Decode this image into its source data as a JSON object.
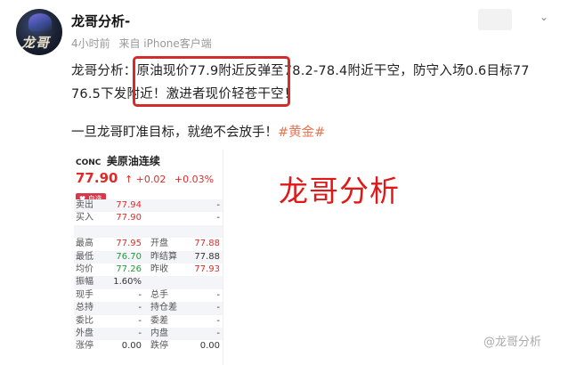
{
  "author": {
    "name": "龙哥分析-",
    "avatar_text": "龙哥"
  },
  "meta": {
    "time": "4小时前",
    "source": "来自 iPhone客户端"
  },
  "post": {
    "line1": "龙哥分析：原油现价77.9附近反弹至78.2-78.4附近干空，防守入场0.6目标77",
    "line2": "76.5下发附近！激进者现价轻苍干空！",
    "line3": "一旦龙哥盯准目标，就绝不会放手！",
    "hashtag": "#黄金#"
  },
  "quote": {
    "code": "CONC",
    "name": "美原油连续",
    "price": "77.90",
    "arrow": "↑",
    "change": "+0.02",
    "change_pct": "+0.03%",
    "tag": "自选",
    "rows": [
      {
        "l1": "卖出",
        "v1": "77.94",
        "l2": "",
        "v2": "-",
        "c1": "red",
        "c2": "dark"
      },
      {
        "l1": "买入",
        "v1": "77.90",
        "l2": "",
        "v2": "-",
        "c1": "red",
        "c2": "dark"
      },
      {
        "l1": "",
        "v1": "",
        "l2": "",
        "v2": "",
        "c1": "dark",
        "c2": "dark"
      },
      {
        "l1": "最高",
        "v1": "77.95",
        "l2": "开盘",
        "v2": "77.88",
        "c1": "red",
        "c2": "red"
      },
      {
        "l1": "最低",
        "v1": "76.70",
        "l2": "昨结算",
        "v2": "77.88",
        "c1": "green",
        "c2": "dark"
      },
      {
        "l1": "均价",
        "v1": "77.26",
        "l2": "昨收",
        "v2": "77.93",
        "c1": "green",
        "c2": "red"
      },
      {
        "l1": "振幅",
        "v1": "1.60%",
        "l2": "",
        "v2": "",
        "c1": "dark",
        "c2": "dark"
      },
      {
        "l1": "现手",
        "v1": "-",
        "l2": "总手",
        "v2": "-",
        "c1": "dark",
        "c2": "dark"
      },
      {
        "l1": "总持",
        "v1": "-",
        "l2": "持仓差",
        "v2": "-",
        "c1": "dark",
        "c2": "dark"
      },
      {
        "l1": "委比",
        "v1": "-",
        "l2": "委差",
        "v2": "-",
        "c1": "dark",
        "c2": "dark"
      },
      {
        "l1": "外盘",
        "v1": "-",
        "l2": "内盘",
        "v2": "-",
        "c1": "dark",
        "c2": "dark"
      },
      {
        "l1": "涨停",
        "v1": "0.00",
        "l2": "跌停",
        "v2": "0.00",
        "c1": "dark",
        "c2": "dark"
      }
    ]
  },
  "watermark": {
    "big": "龙哥分析",
    "small": "@龙哥分析"
  },
  "colors": {
    "highlight_border": "#d42b2b",
    "hashtag": "#eb7350",
    "up": "#e02a2a",
    "down": "#1e9c3a"
  },
  "icons": {
    "more": "chevron-down-icon"
  }
}
